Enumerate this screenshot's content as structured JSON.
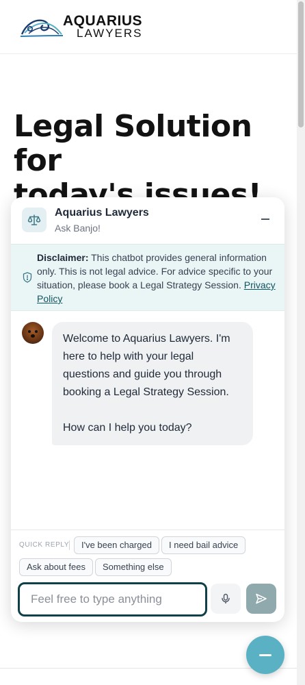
{
  "site": {
    "logo_top": "AQUARIUS",
    "logo_bottom": "LAWYERS",
    "hero_lines": [
      "Legal Solution",
      "for",
      "today's issues!"
    ]
  },
  "chat": {
    "title": "Aquarius Lawyers",
    "subtitle": "Ask Banjo!",
    "disclaimer": {
      "label": "Disclaimer:",
      "text": "This chatbot provides general information only. This is not legal advice. For advice specific to your situation, please book a Legal Strategy Session.",
      "link": "Privacy Policy"
    },
    "messages": [
      {
        "from": "bot",
        "paragraphs": [
          "Welcome to Aquarius Lawyers. I'm here to help with your legal questions and guide you through booking a Legal Strategy Session.",
          "How can I help you today?"
        ]
      }
    ],
    "quick_reply_label": "QUICK REPLY",
    "quick_replies": [
      "I've been charged",
      "I need bail advice",
      "Ask about fees",
      "Something else"
    ],
    "input": {
      "placeholder": "Feel free to type anything",
      "value": ""
    }
  },
  "colors": {
    "accent": "#5ab1c4",
    "input_border": "#0f3f48",
    "disclaimer_bg": "#eaf5f6",
    "send_button": "#8fa9ad"
  },
  "icons": {
    "brand": "scales-icon",
    "disclaimer": "shield-icon",
    "minimize": "minus-icon",
    "mic": "microphone-icon",
    "send": "send-icon",
    "fab": "minus-icon"
  }
}
